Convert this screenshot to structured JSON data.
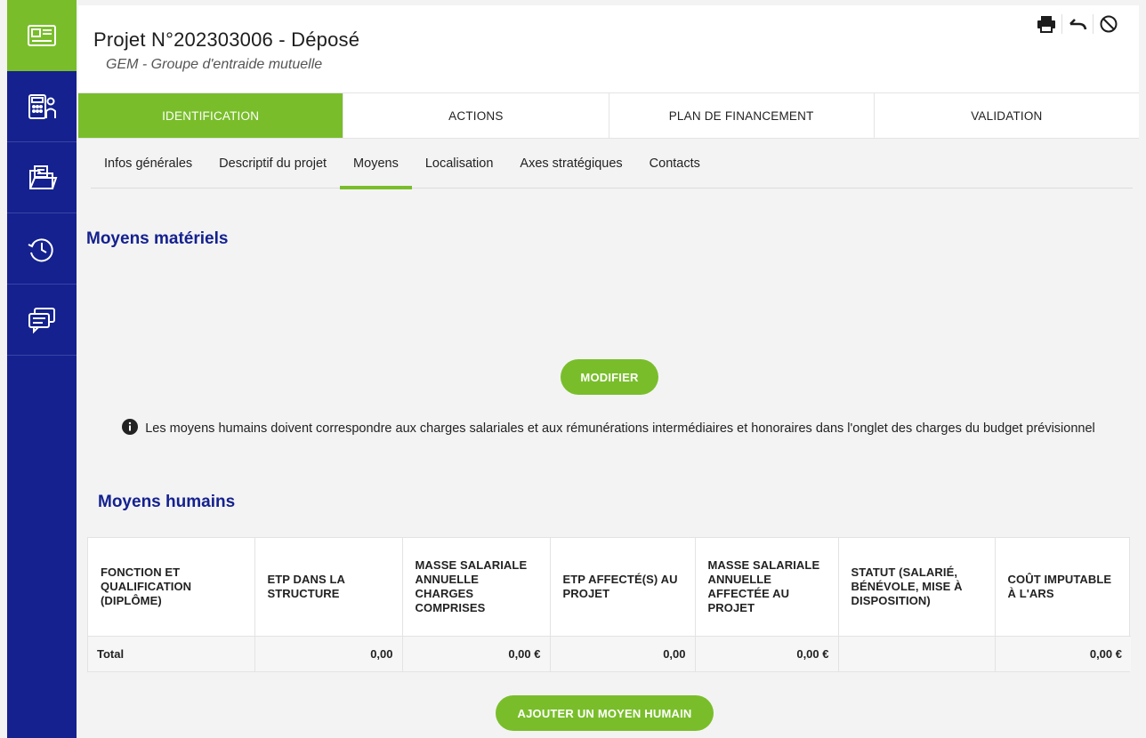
{
  "header": {
    "title": "Projet N°202303006 - Déposé",
    "subtitle": "GEM - Groupe d'entraide mutuelle"
  },
  "tabs": [
    {
      "label": "IDENTIFICATION",
      "active": true
    },
    {
      "label": "ACTIONS",
      "active": false
    },
    {
      "label": "PLAN DE FINANCEMENT",
      "active": false
    },
    {
      "label": "VALIDATION",
      "active": false
    }
  ],
  "subtabs": [
    {
      "label": "Infos générales",
      "active": false
    },
    {
      "label": "Descriptif du projet",
      "active": false
    },
    {
      "label": "Moyens",
      "active": true
    },
    {
      "label": "Localisation",
      "active": false
    },
    {
      "label": "Axes stratégiques",
      "active": false
    },
    {
      "label": "Contacts",
      "active": false
    }
  ],
  "materiels": {
    "title": "Moyens matériels",
    "modify_label": "MODIFIER"
  },
  "info_text": "Les moyens humains doivent correspondre aux charges salariales et aux rémunérations intermédiaires et honoraires dans l'onglet des charges du budget prévisionnel",
  "humains": {
    "title": "Moyens humains",
    "columns": [
      "FONCTION ET QUALIFICATION (DIPLÔME)",
      "ETP DANS LA STRUCTURE",
      "MASSE SALARIALE ANNUELLE CHARGES COMPRISES",
      "ETP AFFECTÉ(S) AU PROJET",
      "MASSE SALARIALE ANNUELLE AFFECTÉE AU PROJET",
      "STATUT (SALARIÉ, BÉNÉVOLE, MISE À DISPOSITION)",
      "COÛT IMPUTABLE À L'ARS"
    ],
    "total_row": [
      "Total",
      "0,00",
      "0,00 €",
      "0,00",
      "0,00 €",
      "",
      "0,00 €"
    ],
    "add_label": "AJOUTER UN MOYEN HUMAIN"
  },
  "sidebar": {
    "items": [
      {
        "icon": "id-card-icon",
        "active": true
      },
      {
        "icon": "calculator-user-icon",
        "active": false
      },
      {
        "icon": "folder-icon",
        "active": false
      },
      {
        "icon": "history-icon",
        "active": false
      },
      {
        "icon": "chat-icon",
        "active": false
      }
    ]
  },
  "colors": {
    "brand_blue": "#14218f",
    "accent_green": "#79be2a"
  }
}
